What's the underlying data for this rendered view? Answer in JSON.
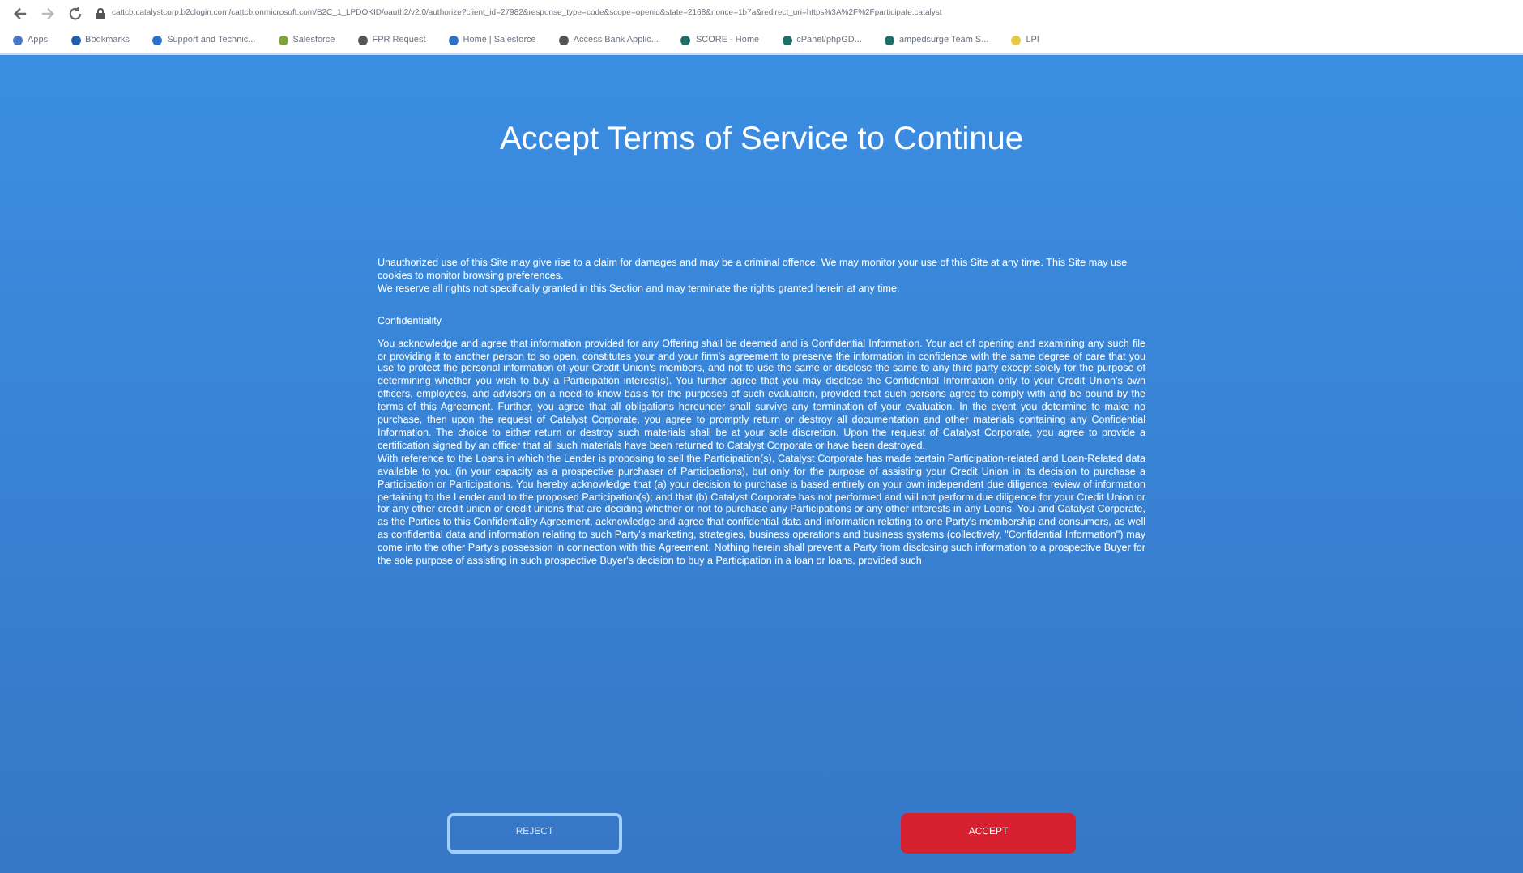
{
  "browser": {
    "address": "cattcb.catalystcorp.b2clogin.com/cattcb.onmicrosoft.com/B2C_1_LPDOKID/oauth2/v2.0/authorize?client_id=27982&response_type=code&scope=openid&state=2168&nonce=1b7a&redirect_uri=https%3A%2F%2Fparticipate.catalyst",
    "bookmarks": [
      {
        "label": "Apps"
      },
      {
        "label": "Bookmarks"
      },
      {
        "label": "Support and Technic..."
      },
      {
        "label": "Salesforce"
      },
      {
        "label": "FPR Request"
      },
      {
        "label": "Home | Salesforce"
      },
      {
        "label": "Access Bank Applic..."
      },
      {
        "label": "SCORE - Home"
      },
      {
        "label": "cPanel/phpGD..."
      },
      {
        "label": "ampedsurge Team S..."
      },
      {
        "label": "LPI"
      }
    ]
  },
  "title": "Accept Terms of Service to Continue",
  "intro": [
    "Unauthorized use of this Site may give rise to a claim for damages and may be a criminal offence. We may monitor your use of this Site at any time. This Site may use cookies to monitor browsing preferences.",
    "We reserve all rights not specifically granted in this Section and may terminate the rights granted herein at any time."
  ],
  "section_heading": "Confidentiality",
  "paragraphs": [
    "You acknowledge and agree that information provided for any Offering shall be deemed and is Confidential Information. Your act of opening and examining any such file or providing it to another person to so open, constitutes your and your firm's agreement to preserve the information in confidence with the same degree of care that you use to protect the personal information of your Credit Union's members, and not to use the same or disclose the same to any third party except solely for the purpose of determining whether you wish to buy a Participation interest(s). You further agree that you may disclose the Confidential Information only to your Credit Union's own officers, employees, and advisors on a need-to-know basis for the purposes of such evaluation, provided that such persons agree to comply with and be bound by the terms of this Agreement. Further, you agree that all obligations hereunder shall survive any termination of your evaluation. In the event you determine to make no purchase, then upon the request of Catalyst Corporate, you agree to promptly return or destroy all documentation and other materials containing any Confidential Information. The choice to either return or destroy such materials shall be at your sole discretion. Upon the request of Catalyst Corporate, you agree to provide a certification signed by an officer that all such materials have been returned to Catalyst Corporate or have been destroyed.",
    "With reference to the Loans in which the Lender is proposing to sell the Participation(s), Catalyst Corporate has made certain Participation-related and Loan-Related data available to you (in your capacity as a prospective purchaser of Participations), but only for the purpose of assisting your Credit Union in its decision to purchase a Participation or Participations. You hereby acknowledge that (a) your decision to purchase is based entirely on your own independent due diligence review of information pertaining to the Lender and to the proposed Participation(s); and that (b) Catalyst Corporate has not performed and will not perform due diligence for your Credit Union or for any other credit union or credit unions that are deciding whether or not to purchase any Participations or any other interests in any Loans. You and Catalyst Corporate, as the Parties to this Confidentiality Agreement, acknowledge and agree that confidential data and information relating to one Party's membership and consumers, as well as confidential data and information relating to such Party's marketing, strategies, business operations and business systems (collectively, \"Confidential Information\") may come into the other Party's possession in connection with this Agreement. Nothing herein shall prevent a Party from disclosing such information to a prospective Buyer for the sole purpose of assisting in such prospective Buyer's decision to buy a Participation in a loan or loans, provided such"
  ],
  "buttons": [
    {
      "label": "REJECT",
      "kind": "outline"
    },
    {
      "label": "ACCEPT",
      "kind": "primary"
    }
  ]
}
